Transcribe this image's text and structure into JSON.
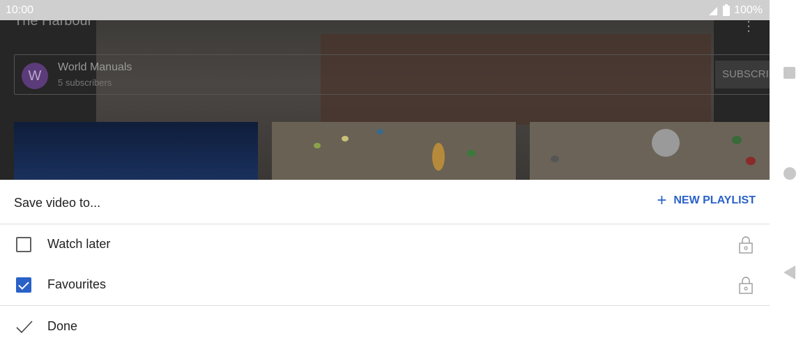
{
  "status_bar": {
    "time": "10:00",
    "battery": "100%"
  },
  "background_page": {
    "video_title": "The Harbour",
    "channel": {
      "avatar_letter": "W",
      "name": "World Manuals",
      "subscribers": "5 subscribers",
      "subscribe_label": "SUBSCRIBE"
    }
  },
  "sheet": {
    "title": "Save video to...",
    "new_playlist_label": "NEW PLAYLIST",
    "playlists": [
      {
        "label": "Watch later",
        "checked": false
      },
      {
        "label": "Favourites",
        "checked": true
      }
    ],
    "done_label": "Done"
  },
  "colors": {
    "accent": "#2a61c9",
    "status_bar": "#cfcfcf"
  }
}
